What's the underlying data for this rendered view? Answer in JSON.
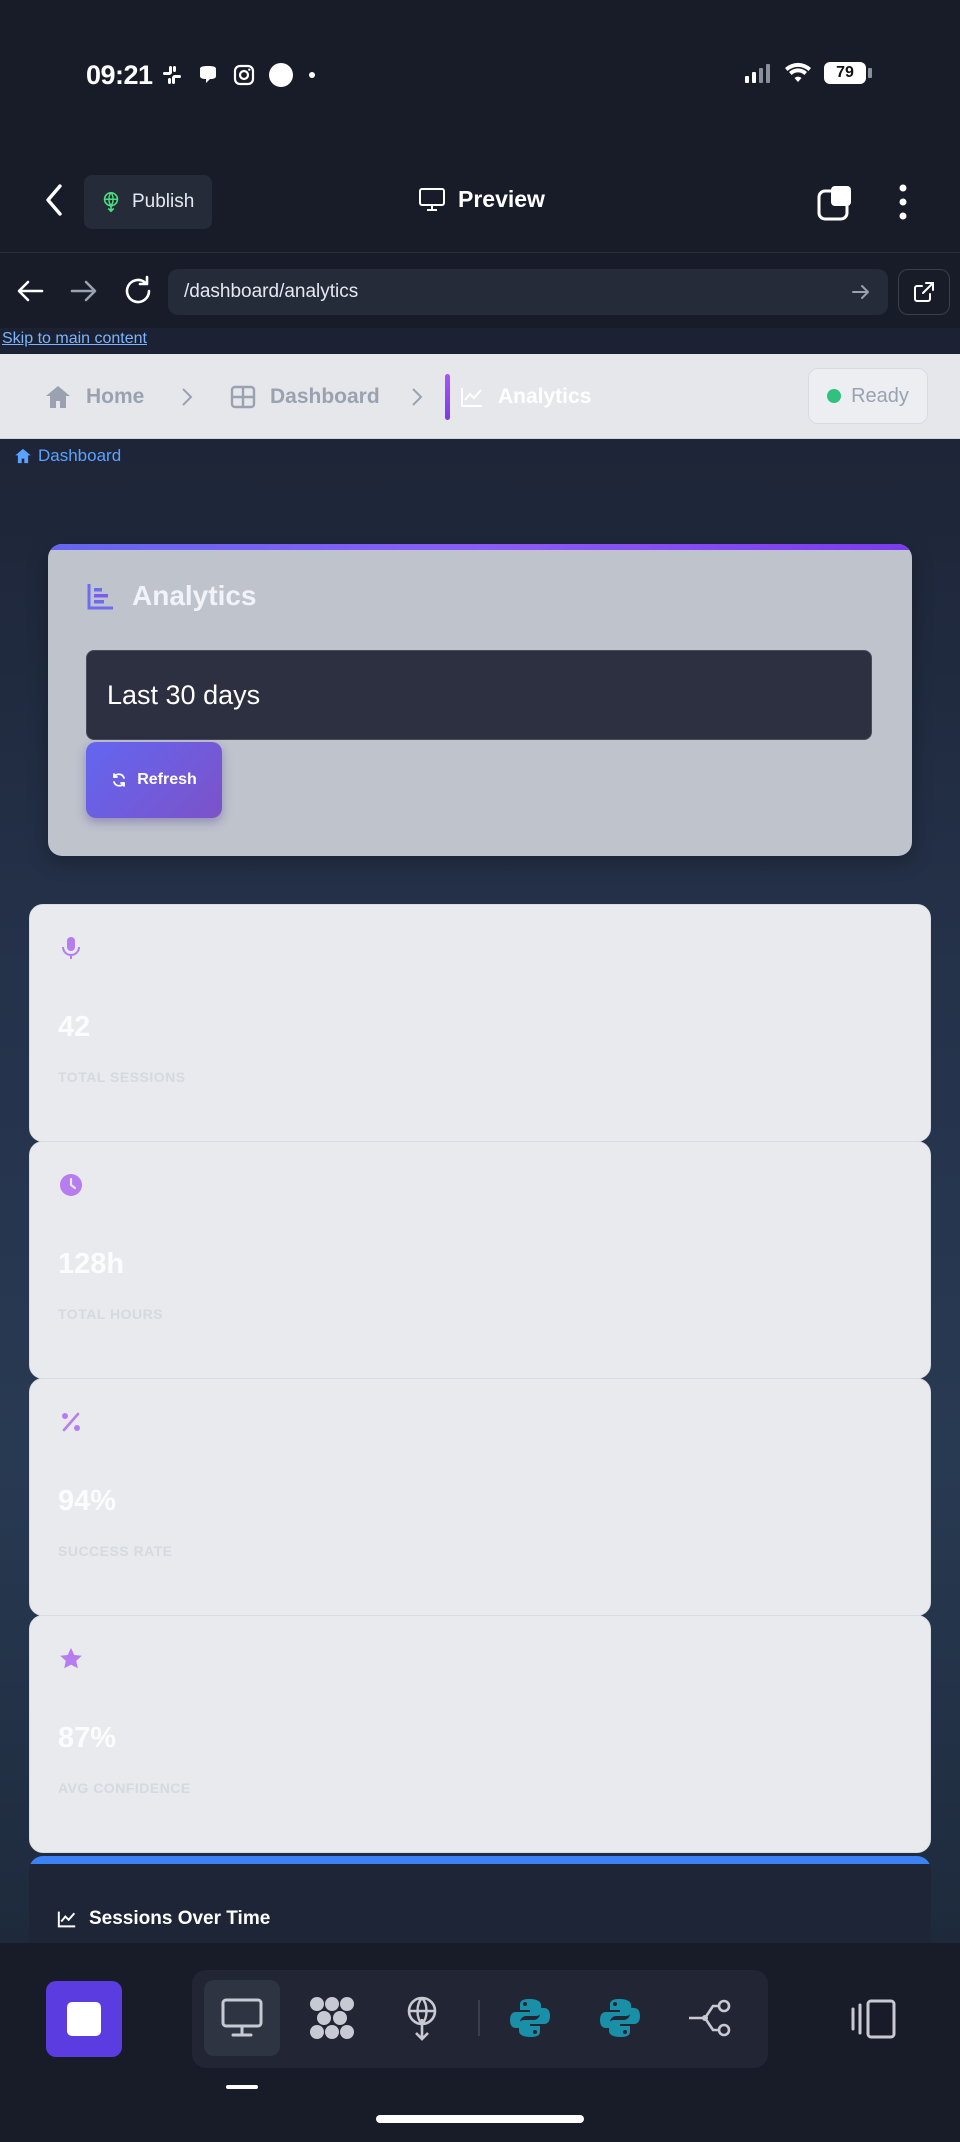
{
  "status_bar": {
    "time": "09:21",
    "battery": "79"
  },
  "app_bar": {
    "publish_label": "Publish",
    "title": "Preview"
  },
  "browser": {
    "url": "/dashboard/analytics"
  },
  "page": {
    "skip_link": "Skip to main content",
    "breadcrumbs": [
      {
        "label": "Home",
        "icon": "home-icon"
      },
      {
        "label": "Dashboard",
        "icon": "grid-icon"
      },
      {
        "label": "Analytics",
        "icon": "line-chart-icon"
      }
    ],
    "status": "Ready",
    "dashboard_link": "Dashboard",
    "analytics_card": {
      "title": "Analytics",
      "range": "Last 30 days",
      "refresh_label": "Refresh"
    },
    "stats": [
      {
        "icon": "microphone-icon",
        "value": "42",
        "label": "TOTAL SESSIONS"
      },
      {
        "icon": "clock-icon",
        "value": "128h",
        "label": "TOTAL HOURS"
      },
      {
        "icon": "percent-icon",
        "value": "94%",
        "label": "SUCCESS RATE"
      },
      {
        "icon": "star-icon",
        "value": "87%",
        "label": "AVG CONFIDENCE"
      }
    ],
    "chart_title": "Sessions Over Time"
  },
  "dock": {
    "items": [
      "desktop-icon",
      "apps-grid-icon",
      "publish-icon",
      "python-icon",
      "python-icon",
      "share-nodes-icon"
    ]
  },
  "colors": {
    "accent_purple": "#7c3aed",
    "status_green": "#2fc17d",
    "link_blue": "#5aa2ff",
    "python_teal": "#1a8fa8"
  }
}
